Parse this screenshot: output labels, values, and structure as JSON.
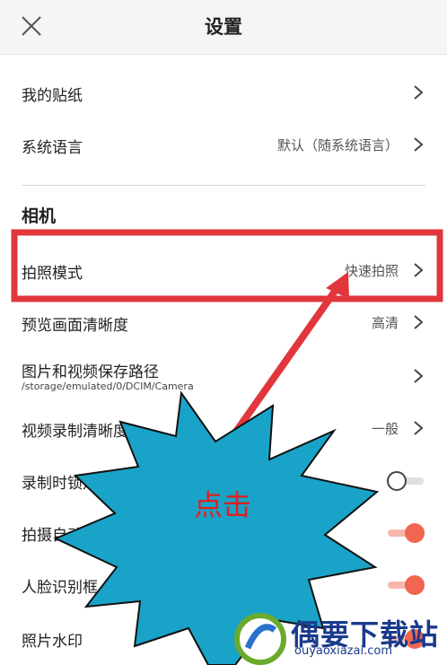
{
  "header": {
    "title": "设置",
    "close_icon": "close-icon"
  },
  "general": {
    "items": [
      {
        "label": "我的贴纸",
        "value": ""
      },
      {
        "label": "系统语言",
        "value": "默认（随系统语言）"
      }
    ]
  },
  "camera": {
    "section_title": "相机",
    "items": [
      {
        "label": "拍照模式",
        "value": "快速拍照"
      },
      {
        "label": "预览画面清晰度",
        "value": "高清"
      },
      {
        "label": "图片和视频保存路径",
        "subtext": "/storage/emulated/0/DCIM/Camera"
      },
      {
        "label": "视频录制清晰度",
        "value": "一般"
      },
      {
        "label": "录制时锁定画面",
        "toggle": false
      },
      {
        "label": "拍摄自动旋转",
        "toggle": true
      },
      {
        "label": "人脸识别框",
        "toggle": true
      },
      {
        "label": "照片水印",
        "toggle": true
      }
    ]
  },
  "annotation": {
    "callout_text": "点击",
    "highlight_color": "#e0363c",
    "burst_color": "#1aa3c8"
  },
  "watermark": {
    "name": "偶要下载站",
    "url": "ouyaoxiazai.com"
  },
  "colors": {
    "toggle_on": "#f06650",
    "toggle_off": "#cccccc"
  }
}
